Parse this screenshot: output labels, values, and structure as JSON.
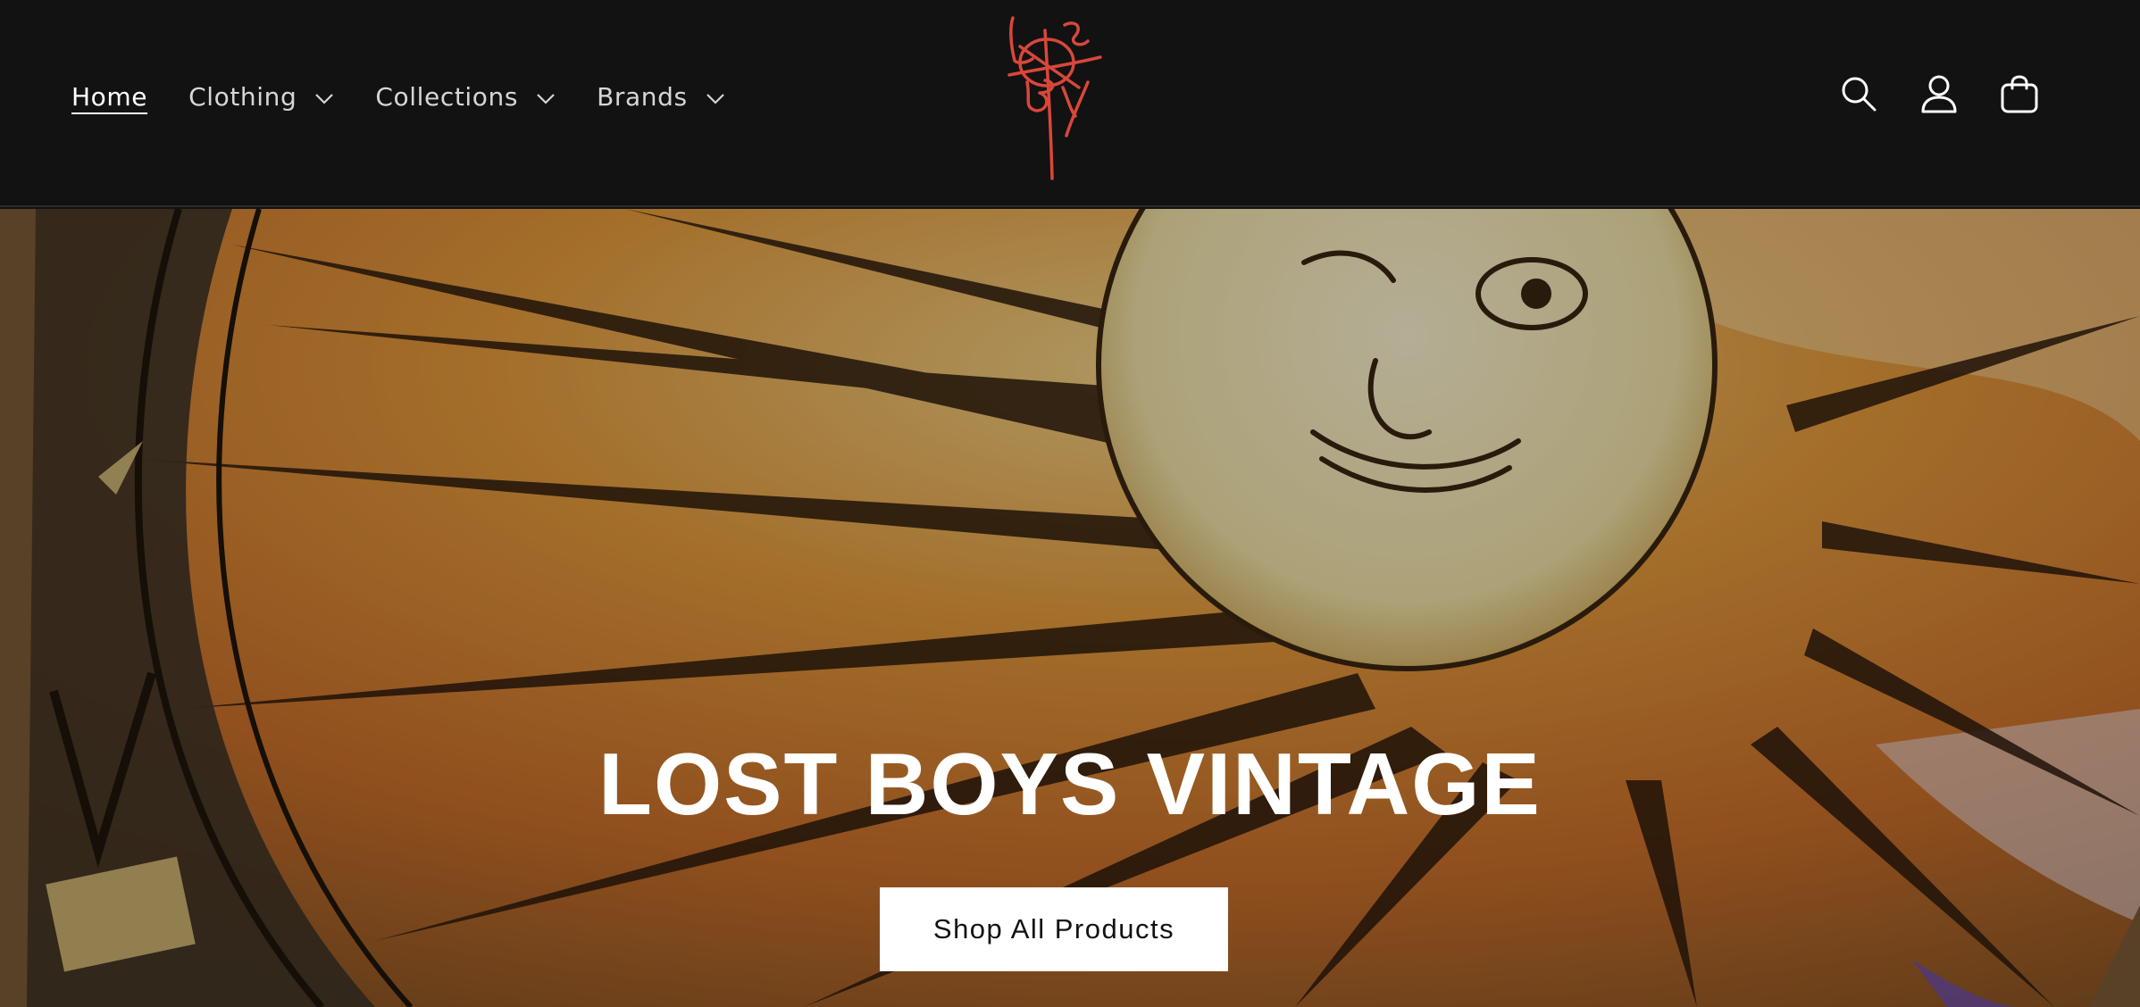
{
  "header": {
    "nav": [
      {
        "label": "Home",
        "active": true,
        "has_dropdown": false
      },
      {
        "label": "Clothing",
        "active": false,
        "has_dropdown": true
      },
      {
        "label": "Collections",
        "active": false,
        "has_dropdown": true
      },
      {
        "label": "Brands",
        "active": false,
        "has_dropdown": true
      }
    ],
    "logo_text": "LBV",
    "icons": [
      "search-icon",
      "account-icon",
      "cart-icon"
    ]
  },
  "hero": {
    "title": "LOST BOYS VINTAGE",
    "button_label": "Shop All Products"
  },
  "colors": {
    "header_bg": "#121212",
    "logo": "#d9473a",
    "hero_text": "#ffffff",
    "button_bg": "#ffffff",
    "button_text": "#121212"
  }
}
